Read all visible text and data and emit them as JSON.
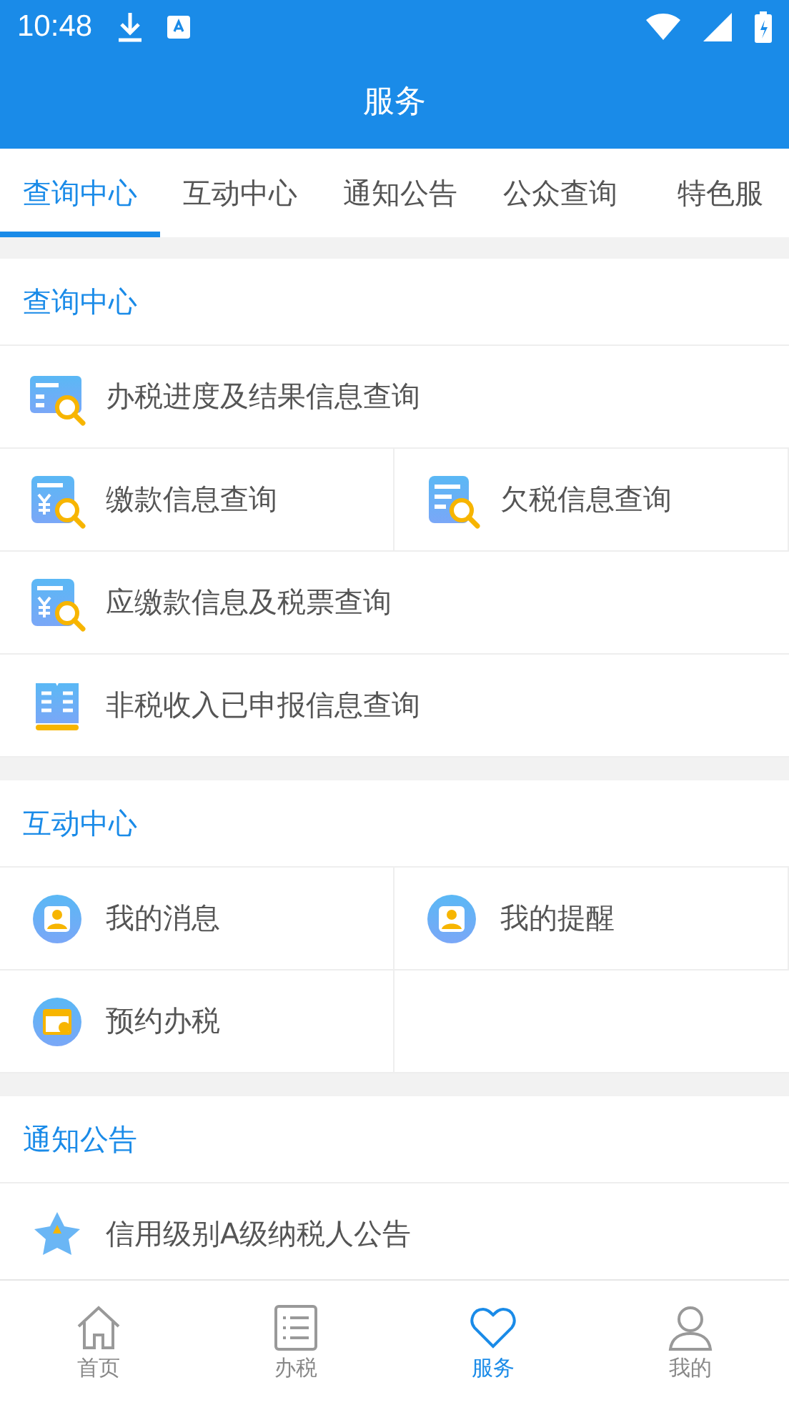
{
  "status_bar": {
    "time": "10:48"
  },
  "header": {
    "title": "服务"
  },
  "tabs": [
    {
      "label": "查询中心",
      "selected": true
    },
    {
      "label": "互动中心",
      "selected": false
    },
    {
      "label": "通知公告",
      "selected": false
    },
    {
      "label": "公众查询",
      "selected": false
    },
    {
      "label": "特色服",
      "selected": false
    }
  ],
  "sections": [
    {
      "title": "查询中心",
      "rows": [
        {
          "kind": "wide",
          "items": [
            {
              "kind": "progress",
              "label": "办税进度及结果信息查询"
            }
          ]
        },
        {
          "kind": "split",
          "items": [
            {
              "kind": "payment",
              "label": "缴款信息查询"
            },
            {
              "kind": "arrears",
              "label": "欠税信息查询"
            }
          ]
        },
        {
          "kind": "wide",
          "items": [
            {
              "kind": "payment",
              "label": "应缴款信息及税票查询"
            }
          ]
        },
        {
          "kind": "wide",
          "items": [
            {
              "kind": "book",
              "label": "非税收入已申报信息查询"
            }
          ]
        }
      ]
    },
    {
      "title": "互动中心",
      "rows": [
        {
          "kind": "split",
          "items": [
            {
              "kind": "person",
              "label": "我的消息"
            },
            {
              "kind": "person",
              "label": "我的提醒"
            }
          ]
        },
        {
          "kind": "split",
          "items": [
            {
              "kind": "calendar",
              "label": "预约办税"
            }
          ]
        }
      ]
    },
    {
      "title": "通知公告",
      "rows": [
        {
          "kind": "wide",
          "items": [
            {
              "kind": "star",
              "label": "信用级别A级纳税人公告"
            }
          ]
        }
      ]
    }
  ],
  "bottom_nav": [
    {
      "kind": "home",
      "label": "首页",
      "selected": false
    },
    {
      "kind": "list",
      "label": "办税",
      "selected": false
    },
    {
      "kind": "heart",
      "label": "服务",
      "selected": true
    },
    {
      "kind": "person",
      "label": "我的",
      "selected": false
    }
  ]
}
